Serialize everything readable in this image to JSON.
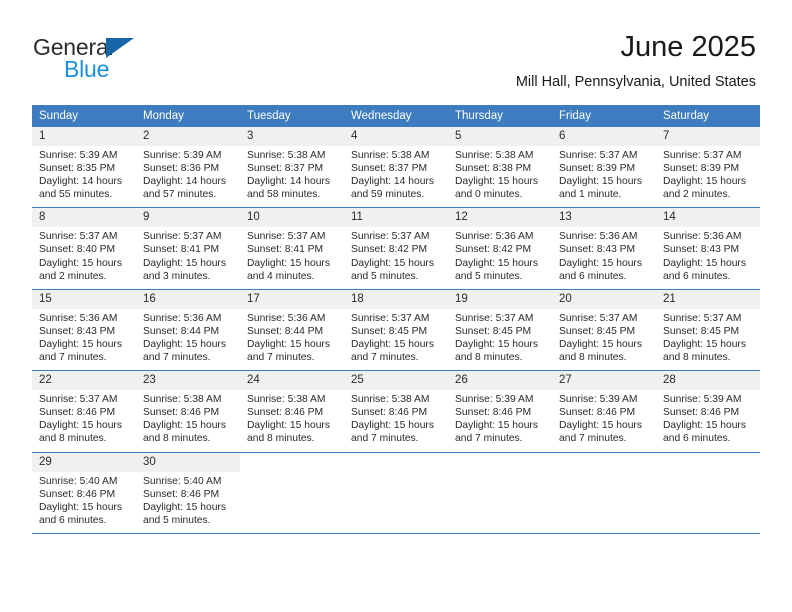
{
  "brand": {
    "name_part1": "General",
    "name_part2": "Blue",
    "triangle_color": "#1565a8",
    "blue_color": "#1a8fe0"
  },
  "header": {
    "title": "June 2025",
    "subtitle": "Mill Hall, Pennsylvania, United States"
  },
  "theme": {
    "header_bg": "#3d7dbf",
    "daynum_bg": "#f0f0f0",
    "text": "#2b2b2b"
  },
  "weekdays": [
    "Sunday",
    "Monday",
    "Tuesday",
    "Wednesday",
    "Thursday",
    "Friday",
    "Saturday"
  ],
  "weeks": [
    [
      {
        "day": "1",
        "sunrise": "Sunrise: 5:39 AM",
        "sunset": "Sunset: 8:35 PM",
        "daylight": "Daylight: 14 hours and 55 minutes."
      },
      {
        "day": "2",
        "sunrise": "Sunrise: 5:39 AM",
        "sunset": "Sunset: 8:36 PM",
        "daylight": "Daylight: 14 hours and 57 minutes."
      },
      {
        "day": "3",
        "sunrise": "Sunrise: 5:38 AM",
        "sunset": "Sunset: 8:37 PM",
        "daylight": "Daylight: 14 hours and 58 minutes."
      },
      {
        "day": "4",
        "sunrise": "Sunrise: 5:38 AM",
        "sunset": "Sunset: 8:37 PM",
        "daylight": "Daylight: 14 hours and 59 minutes."
      },
      {
        "day": "5",
        "sunrise": "Sunrise: 5:38 AM",
        "sunset": "Sunset: 8:38 PM",
        "daylight": "Daylight: 15 hours and 0 minutes."
      },
      {
        "day": "6",
        "sunrise": "Sunrise: 5:37 AM",
        "sunset": "Sunset: 8:39 PM",
        "daylight": "Daylight: 15 hours and 1 minute."
      },
      {
        "day": "7",
        "sunrise": "Sunrise: 5:37 AM",
        "sunset": "Sunset: 8:39 PM",
        "daylight": "Daylight: 15 hours and 2 minutes."
      }
    ],
    [
      {
        "day": "8",
        "sunrise": "Sunrise: 5:37 AM",
        "sunset": "Sunset: 8:40 PM",
        "daylight": "Daylight: 15 hours and 2 minutes."
      },
      {
        "day": "9",
        "sunrise": "Sunrise: 5:37 AM",
        "sunset": "Sunset: 8:41 PM",
        "daylight": "Daylight: 15 hours and 3 minutes."
      },
      {
        "day": "10",
        "sunrise": "Sunrise: 5:37 AM",
        "sunset": "Sunset: 8:41 PM",
        "daylight": "Daylight: 15 hours and 4 minutes."
      },
      {
        "day": "11",
        "sunrise": "Sunrise: 5:37 AM",
        "sunset": "Sunset: 8:42 PM",
        "daylight": "Daylight: 15 hours and 5 minutes."
      },
      {
        "day": "12",
        "sunrise": "Sunrise: 5:36 AM",
        "sunset": "Sunset: 8:42 PM",
        "daylight": "Daylight: 15 hours and 5 minutes."
      },
      {
        "day": "13",
        "sunrise": "Sunrise: 5:36 AM",
        "sunset": "Sunset: 8:43 PM",
        "daylight": "Daylight: 15 hours and 6 minutes."
      },
      {
        "day": "14",
        "sunrise": "Sunrise: 5:36 AM",
        "sunset": "Sunset: 8:43 PM",
        "daylight": "Daylight: 15 hours and 6 minutes."
      }
    ],
    [
      {
        "day": "15",
        "sunrise": "Sunrise: 5:36 AM",
        "sunset": "Sunset: 8:43 PM",
        "daylight": "Daylight: 15 hours and 7 minutes."
      },
      {
        "day": "16",
        "sunrise": "Sunrise: 5:36 AM",
        "sunset": "Sunset: 8:44 PM",
        "daylight": "Daylight: 15 hours and 7 minutes."
      },
      {
        "day": "17",
        "sunrise": "Sunrise: 5:36 AM",
        "sunset": "Sunset: 8:44 PM",
        "daylight": "Daylight: 15 hours and 7 minutes."
      },
      {
        "day": "18",
        "sunrise": "Sunrise: 5:37 AM",
        "sunset": "Sunset: 8:45 PM",
        "daylight": "Daylight: 15 hours and 7 minutes."
      },
      {
        "day": "19",
        "sunrise": "Sunrise: 5:37 AM",
        "sunset": "Sunset: 8:45 PM",
        "daylight": "Daylight: 15 hours and 8 minutes."
      },
      {
        "day": "20",
        "sunrise": "Sunrise: 5:37 AM",
        "sunset": "Sunset: 8:45 PM",
        "daylight": "Daylight: 15 hours and 8 minutes."
      },
      {
        "day": "21",
        "sunrise": "Sunrise: 5:37 AM",
        "sunset": "Sunset: 8:45 PM",
        "daylight": "Daylight: 15 hours and 8 minutes."
      }
    ],
    [
      {
        "day": "22",
        "sunrise": "Sunrise: 5:37 AM",
        "sunset": "Sunset: 8:46 PM",
        "daylight": "Daylight: 15 hours and 8 minutes."
      },
      {
        "day": "23",
        "sunrise": "Sunrise: 5:38 AM",
        "sunset": "Sunset: 8:46 PM",
        "daylight": "Daylight: 15 hours and 8 minutes."
      },
      {
        "day": "24",
        "sunrise": "Sunrise: 5:38 AM",
        "sunset": "Sunset: 8:46 PM",
        "daylight": "Daylight: 15 hours and 8 minutes."
      },
      {
        "day": "25",
        "sunrise": "Sunrise: 5:38 AM",
        "sunset": "Sunset: 8:46 PM",
        "daylight": "Daylight: 15 hours and 7 minutes."
      },
      {
        "day": "26",
        "sunrise": "Sunrise: 5:39 AM",
        "sunset": "Sunset: 8:46 PM",
        "daylight": "Daylight: 15 hours and 7 minutes."
      },
      {
        "day": "27",
        "sunrise": "Sunrise: 5:39 AM",
        "sunset": "Sunset: 8:46 PM",
        "daylight": "Daylight: 15 hours and 7 minutes."
      },
      {
        "day": "28",
        "sunrise": "Sunrise: 5:39 AM",
        "sunset": "Sunset: 8:46 PM",
        "daylight": "Daylight: 15 hours and 6 minutes."
      }
    ],
    [
      {
        "day": "29",
        "sunrise": "Sunrise: 5:40 AM",
        "sunset": "Sunset: 8:46 PM",
        "daylight": "Daylight: 15 hours and 6 minutes."
      },
      {
        "day": "30",
        "sunrise": "Sunrise: 5:40 AM",
        "sunset": "Sunset: 8:46 PM",
        "daylight": "Daylight: 15 hours and 5 minutes."
      },
      {
        "day": "",
        "sunrise": "",
        "sunset": "",
        "daylight": ""
      },
      {
        "day": "",
        "sunrise": "",
        "sunset": "",
        "daylight": ""
      },
      {
        "day": "",
        "sunrise": "",
        "sunset": "",
        "daylight": ""
      },
      {
        "day": "",
        "sunrise": "",
        "sunset": "",
        "daylight": ""
      },
      {
        "day": "",
        "sunrise": "",
        "sunset": "",
        "daylight": ""
      }
    ]
  ]
}
